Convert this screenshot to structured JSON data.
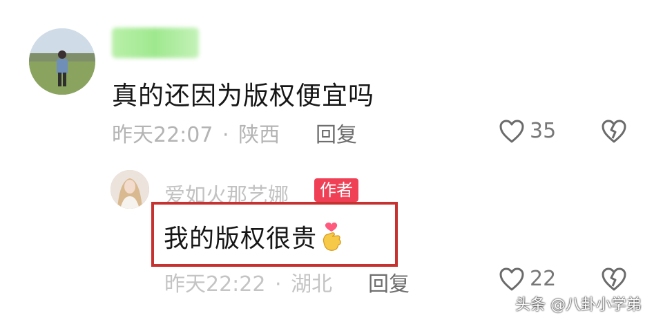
{
  "comment": {
    "text": "真的还因为版权便宜吗",
    "time": "昨天22:07",
    "separator": "·",
    "location": "陕西",
    "reply_label": "回复",
    "likes": "35"
  },
  "reply": {
    "username": "爱如火那艺娜",
    "author_badge": "作者",
    "text": "我的版权很贵",
    "emoji": "🫰",
    "time": "昨天22:22",
    "separator": "·",
    "location": "湖北",
    "reply_label": "回复",
    "likes": "22"
  },
  "watermark": "头条 @八卦小学弟",
  "colors": {
    "badge": "#ef4056",
    "highlight_border": "#c6322f",
    "blurred_name": "#a8ec98"
  },
  "icons": [
    "heart-outline-icon",
    "broken-heart-icon",
    "finger-heart-emoji"
  ]
}
